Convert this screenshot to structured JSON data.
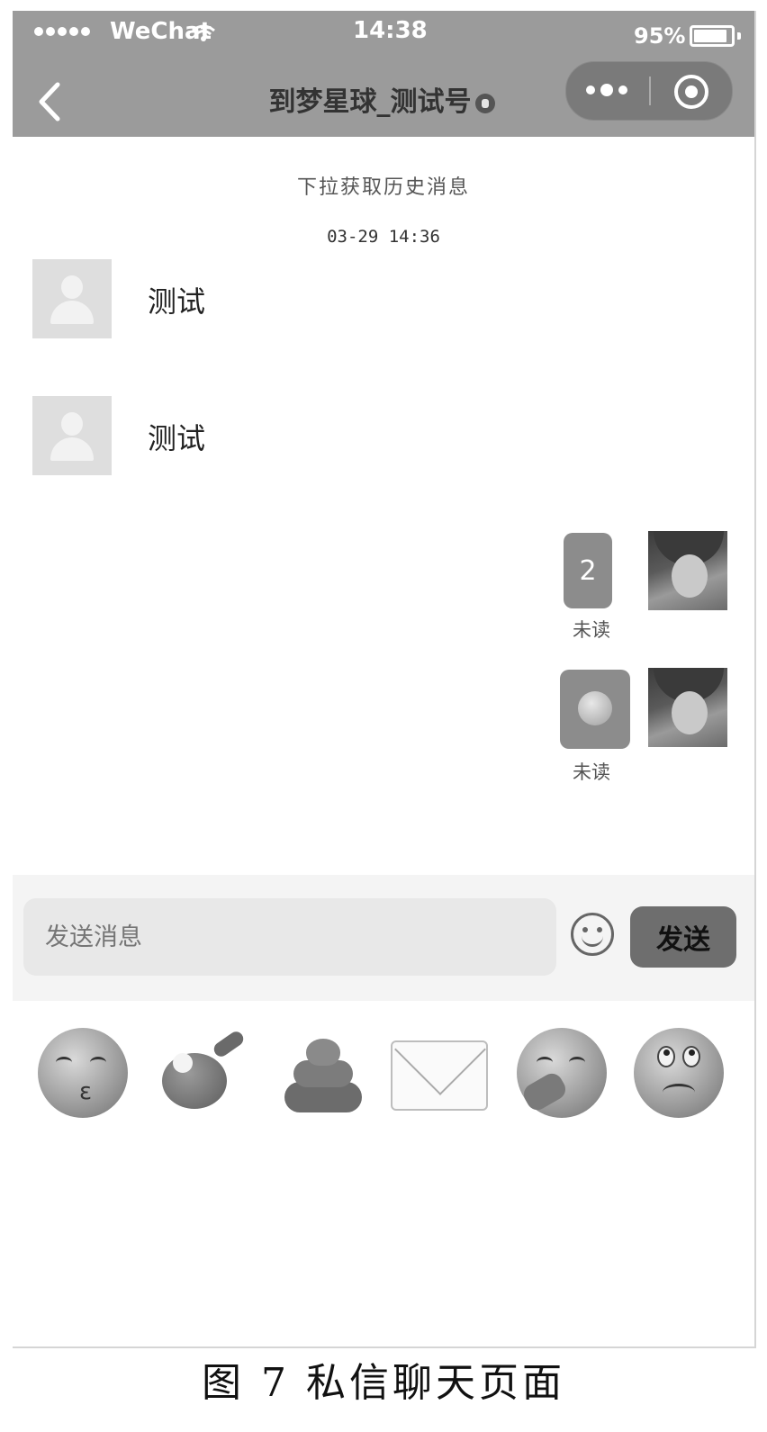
{
  "status_bar": {
    "carrier": "WeChat",
    "time": "14:38",
    "battery": "95%",
    "battery_level": 0.95
  },
  "header": {
    "title": "到梦星球_测试号",
    "back_icon": "chevron-left-icon",
    "more_icon": "more-dots-icon",
    "close_icon": "target-circle-icon"
  },
  "chat": {
    "history_hint": "下拉获取历史消息",
    "timestamp": "03-29 14:36",
    "messages": [
      {
        "side": "left",
        "text": "测试",
        "avatar": "default-avatar"
      },
      {
        "side": "left",
        "text": "测试",
        "avatar": "default-avatar"
      },
      {
        "side": "right",
        "text": "2",
        "status": "未读",
        "avatar": "user-photo"
      },
      {
        "side": "right",
        "emoji": "face-emoji",
        "status": "未读",
        "avatar": "user-photo"
      }
    ]
  },
  "input_bar": {
    "placeholder": "发送消息",
    "emoji_icon": "smile-icon",
    "send_label": "发送"
  },
  "emoji_panel": {
    "items": [
      "kissing-face",
      "ping-pong",
      "poop",
      "envelope",
      "face-with-hand-over-mouth",
      "rolling-eyes-face"
    ]
  },
  "caption": "图 7   私信聊天页面",
  "colors": {
    "header_bg": "#9b9b9b",
    "bubble_bg": "#8c8c8c",
    "send_button_bg": "#6e6e6e",
    "input_bg": "#e8e8e8"
  }
}
